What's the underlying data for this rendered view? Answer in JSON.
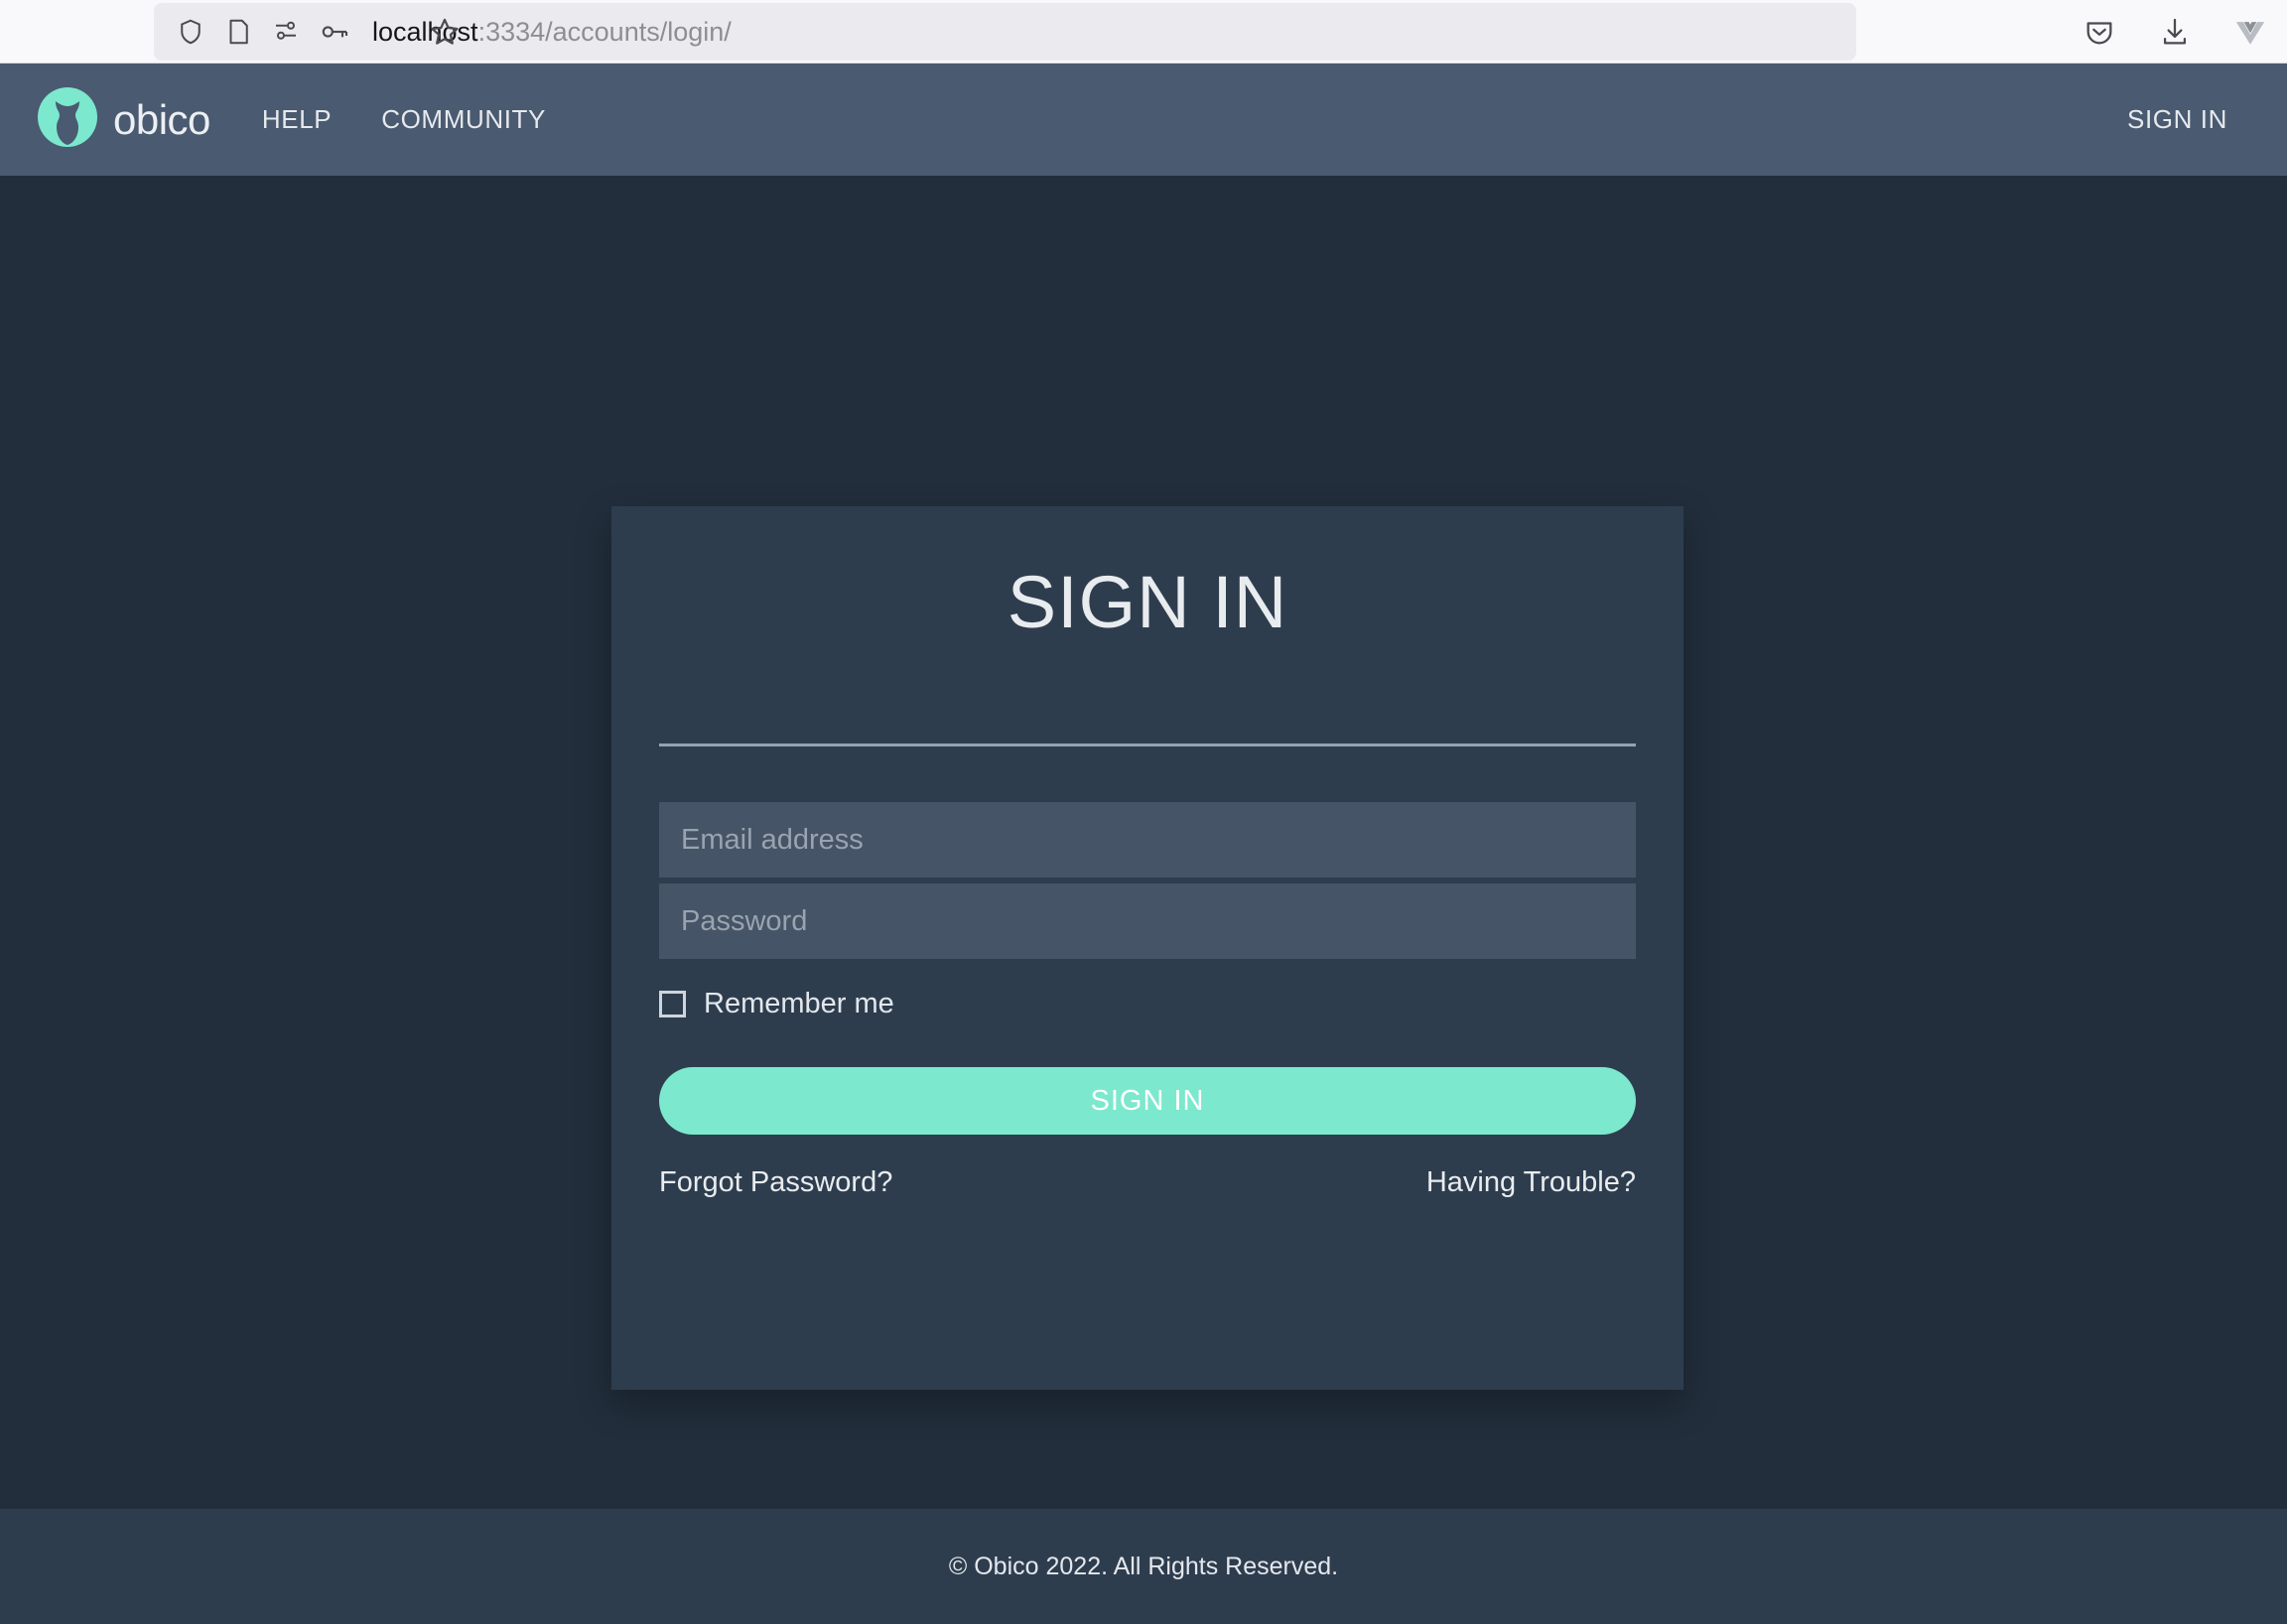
{
  "browser": {
    "url_host": "localhost",
    "url_path": ":3334/accounts/login/",
    "icons": {
      "shield": "shield-icon",
      "page": "page-icon",
      "permissions": "permissions-icon",
      "key": "key-icon",
      "bookmark": "star-icon",
      "pocket": "pocket-icon",
      "downloads": "download-icon",
      "vue_devtools": "vue-devtools-icon"
    }
  },
  "navbar": {
    "brand_name": "obico",
    "brand_logo": "obico-cat-logo-icon",
    "links": [
      {
        "label": "HELP"
      },
      {
        "label": "COMMUNITY"
      }
    ],
    "signin_label": "SIGN IN"
  },
  "card": {
    "title": "SIGN IN",
    "email": {
      "placeholder": "Email address",
      "value": ""
    },
    "password": {
      "placeholder": "Password",
      "value": ""
    },
    "remember_me_label": "Remember me",
    "remember_me_checked": false,
    "submit_label": "SIGN IN",
    "forgot_password_label": "Forgot Password?",
    "having_trouble_label": "Having Trouble?"
  },
  "footer": {
    "copyright": "© Obico 2022. All Rights Reserved."
  },
  "colors": {
    "brand_teal": "#7ce8cd",
    "navbar_bg": "#4a5a70",
    "page_bg": "#222e3c",
    "card_bg": "#2e3d4e",
    "input_bg": "#455467",
    "footer_bg": "#2e3d4e"
  }
}
